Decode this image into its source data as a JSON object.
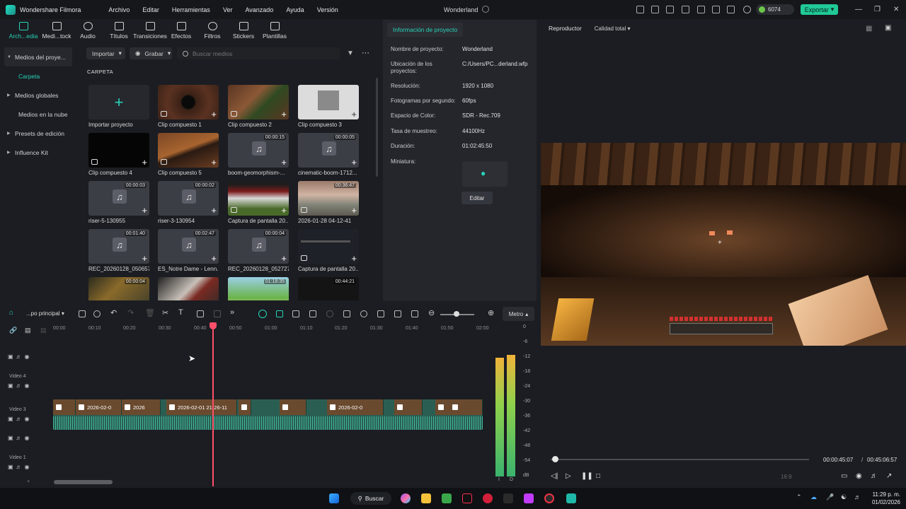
{
  "app": {
    "name": "Wondershare Filmora",
    "project_title": "Wonderland",
    "credits": "6074",
    "export_label": "Exportar"
  },
  "menu": [
    "Archivo",
    "Editar",
    "Herramientas",
    "Ver",
    "Avanzado",
    "Ayuda",
    "Versión"
  ],
  "media_tabs": [
    {
      "label": "Arch...edia",
      "active": true
    },
    {
      "label": "Medi...tock",
      "active": false
    },
    {
      "label": "Audio",
      "active": false
    },
    {
      "label": "Títulos",
      "active": false
    },
    {
      "label": "Transiciones",
      "active": false
    },
    {
      "label": "Efectos",
      "active": false
    },
    {
      "label": "Filtros",
      "active": false
    },
    {
      "label": "Stickers",
      "active": false
    },
    {
      "label": "Plantillas",
      "active": false
    }
  ],
  "sidebar": [
    {
      "label": "Medios del proye...",
      "type": "expanded"
    },
    {
      "label": "Carpeta",
      "type": "sub"
    },
    {
      "label": "Medios globales",
      "type": "collapsed"
    },
    {
      "label": "Medios en la nube",
      "type": "plain"
    },
    {
      "label": "Presets de edición",
      "type": "collapsed"
    },
    {
      "label": "Influence Kit",
      "type": "collapsed"
    }
  ],
  "media_toolbar": {
    "import_label": "Importar",
    "record_label": "Grabar",
    "search_placeholder": "Buscar medios"
  },
  "folder_label": "CARPETA",
  "media_items": [
    {
      "label": "Importar proyecto",
      "kind": "import",
      "duration": ""
    },
    {
      "label": "Clip compuesto 1",
      "kind": "compound",
      "duration": ""
    },
    {
      "label": "Clip compuesto 2",
      "kind": "compound",
      "duration": ""
    },
    {
      "label": "Clip compuesto 3",
      "kind": "compound",
      "duration": ""
    },
    {
      "label": "Clip compuesto 4",
      "kind": "compound",
      "duration": ""
    },
    {
      "label": "Clip compuesto 5",
      "kind": "compound",
      "duration": ""
    },
    {
      "label": "boom-geomorphism-...",
      "kind": "audio",
      "duration": "00:00:15"
    },
    {
      "label": "cinematic-boom-1712...",
      "kind": "audio",
      "duration": "00:00:05"
    },
    {
      "label": "riser-5-130955",
      "kind": "audio",
      "duration": "00:00:03"
    },
    {
      "label": "riser-3-130954",
      "kind": "audio",
      "duration": "00:00:02"
    },
    {
      "label": "Captura de pantalla 20...",
      "kind": "image",
      "duration": ""
    },
    {
      "label": "2026-01-28 04-12-41",
      "kind": "video",
      "duration": "00:36:47"
    },
    {
      "label": "REC_20260128_050657",
      "kind": "audio",
      "duration": "00:01:40"
    },
    {
      "label": "ES_Notre Dame - Lenn...",
      "kind": "audio",
      "duration": "00:02:47"
    },
    {
      "label": "REC_20260128_052727",
      "kind": "audio",
      "duration": "00:00:04"
    },
    {
      "label": "Captura de pantalla 20...",
      "kind": "image",
      "duration": ""
    },
    {
      "label": "",
      "kind": "video",
      "duration": "00:00:04"
    },
    {
      "label": "",
      "kind": "video",
      "duration": ""
    },
    {
      "label": "",
      "kind": "video",
      "duration": "01:18:35"
    },
    {
      "label": "",
      "kind": "video",
      "duration": "00:44:21"
    }
  ],
  "project_info": {
    "tab_label": "Información de proyecto",
    "rows": [
      {
        "key": "Nombre de proyecto:",
        "value": "Wonderland"
      },
      {
        "key": "Ubicación de los proyectos:",
        "value": "C:/Users/PC...derland.wfp"
      },
      {
        "key": "Resolución:",
        "value": "1920 x 1080"
      },
      {
        "key": "Fotogramas por segundo:",
        "value": "60fps"
      },
      {
        "key": "Espacio de Color:",
        "value": "SDR - Rec.709"
      },
      {
        "key": "Tasa de muestreo:",
        "value": "44100Hz"
      },
      {
        "key": "Duración:",
        "value": "01:02:45:50"
      },
      {
        "key": "Miniatura:",
        "value": ""
      }
    ],
    "edit_label": "Editar"
  },
  "player": {
    "label": "Reproductor",
    "quality": "Calidad total",
    "current_time": "00:00:45:07",
    "separator": "/",
    "total_time": "00:45:06:57",
    "progress": 0.017,
    "aspect": "16:9"
  },
  "timeline": {
    "sequence": "...po principal",
    "meter_label": "Metro",
    "ruler": [
      "00:00",
      "00:10",
      "00:20",
      "00:30",
      "00:40",
      "00:50",
      "01:00",
      "01:10",
      "01:20",
      "01:30",
      "01:40",
      "01:50",
      "02:00"
    ],
    "tracks": [
      "Video 4",
      "Video 3",
      "Video 1"
    ],
    "clips": [
      "2026-02-0",
      "2026",
      "2026-02-01 21-26-11",
      "",
      "",
      "2026-02-0",
      ""
    ],
    "meter_ticks": [
      "0",
      "-6",
      "-12",
      "-18",
      "-24",
      "-30",
      "-36",
      "-42",
      "-48",
      "-54",
      "dB"
    ],
    "meter_channels": [
      "I",
      "D"
    ]
  },
  "taskbar": {
    "search": "Buscar",
    "time": "11:29 p. m.",
    "date": "01/02/2026"
  }
}
